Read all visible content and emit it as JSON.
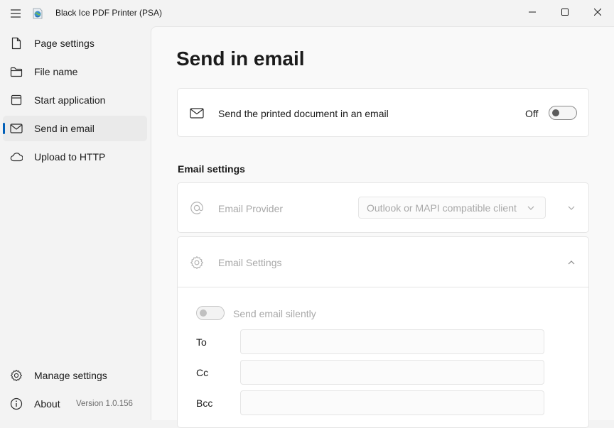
{
  "window": {
    "title": "Black Ice PDF Printer (PSA)",
    "icons": {
      "menu": "hamburger-icon",
      "app": "black-ice-app-icon",
      "minimize": "minimize-icon",
      "maximize": "maximize-icon",
      "close": "close-icon"
    }
  },
  "sidebar": {
    "items": [
      {
        "label": "Page settings",
        "icon": "page-icon"
      },
      {
        "label": "File name",
        "icon": "folder-icon"
      },
      {
        "label": "Start application",
        "icon": "start-app-icon"
      },
      {
        "label": "Send in email",
        "icon": "mail-icon",
        "selected": true
      },
      {
        "label": "Upload to HTTP",
        "icon": "cloud-icon"
      }
    ],
    "footer": [
      {
        "label": "Manage settings",
        "icon": "gear-icon"
      },
      {
        "label": "About",
        "icon": "info-icon",
        "version": "Version 1.0.156"
      }
    ]
  },
  "main": {
    "title": "Send in email",
    "send_card": {
      "label": "Send the printed document in an email",
      "state_text": "Off",
      "enabled": false,
      "icon": "mail-icon"
    },
    "section_heading": "Email settings",
    "provider": {
      "label": "Email Provider",
      "value": "Outlook or MAPI compatible client",
      "icon": "at-sign-icon"
    },
    "email_settings": {
      "label": "Email Settings",
      "icon": "gear-icon",
      "expanded": true,
      "silent_label": "Send email silently",
      "silent_enabled": false,
      "fields": [
        {
          "label": "To",
          "value": ""
        },
        {
          "label": "Cc",
          "value": ""
        },
        {
          "label": "Bcc",
          "value": ""
        }
      ]
    }
  },
  "colors": {
    "accent": "#005fb8",
    "window_bg": "#f3f3f3",
    "content_bg": "#f9f9f9",
    "card_bg": "#ffffff",
    "disabled_text": "#a8a8a8"
  }
}
